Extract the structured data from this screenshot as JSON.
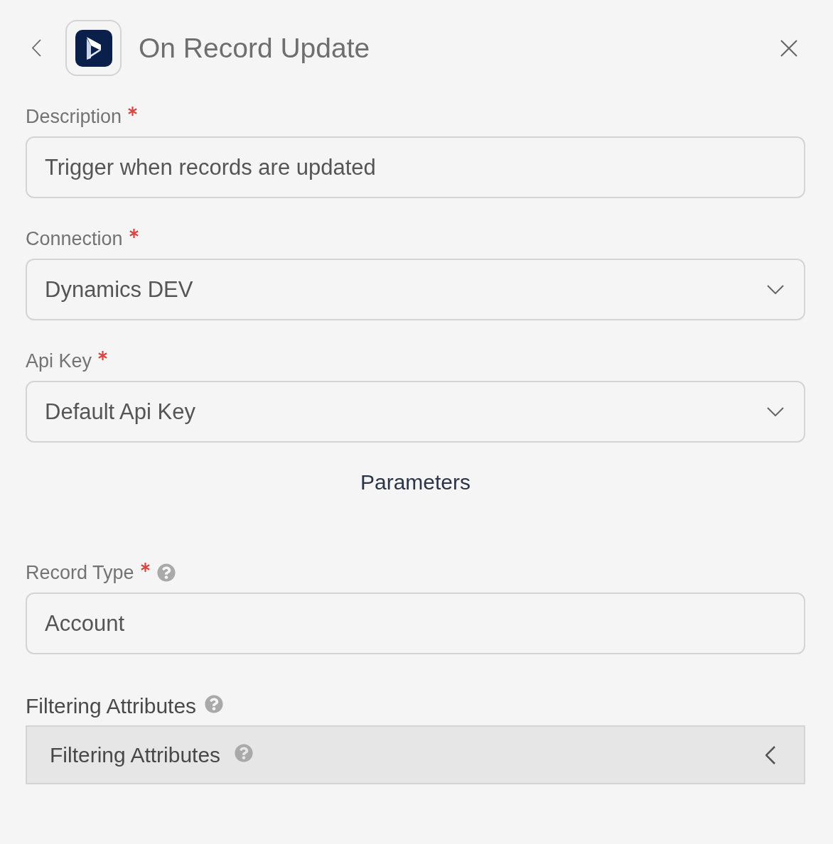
{
  "header": {
    "title": "On Record Update"
  },
  "fields": [
    {
      "kind": "text",
      "label": "Description",
      "required": true,
      "help": false,
      "value": "Trigger when records are updated"
    },
    {
      "kind": "select",
      "label": "Connection",
      "required": true,
      "help": false,
      "value": "Dynamics DEV"
    },
    {
      "kind": "select",
      "label": "Api Key",
      "required": true,
      "help": false,
      "value": "Default Api Key"
    }
  ],
  "section": {
    "title": "Parameters"
  },
  "parameters": [
    {
      "kind": "text",
      "label": "Record Type",
      "required": true,
      "help": true,
      "value": "Account"
    },
    {
      "kind": "group",
      "label": "Filtering Attributes",
      "required": false,
      "help": true,
      "panel": {
        "title": "Filtering Attributes",
        "help": true,
        "expanded": false
      }
    }
  ]
}
